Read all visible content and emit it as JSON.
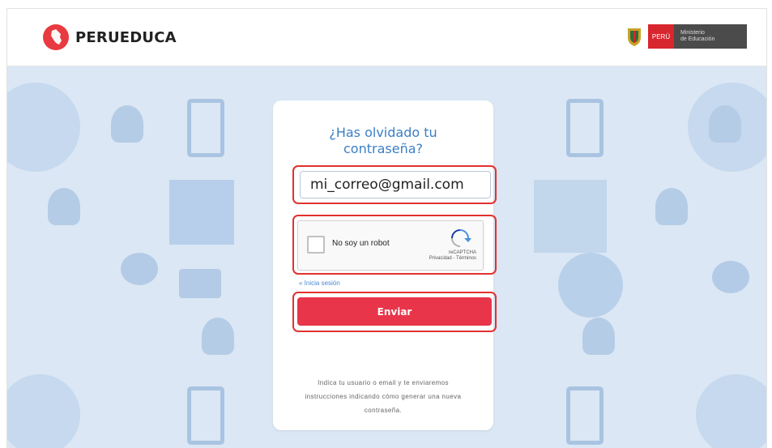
{
  "header": {
    "brand": "PERUEDUCA",
    "gov_peru": "PERÚ",
    "gov_ministry_line1": "Ministerio",
    "gov_ministry_line2": "de Educación"
  },
  "form": {
    "title_line1": "¿Has olvidado tu",
    "title_line2": "contraseña?",
    "email_value": "mi_correo@gmail.com",
    "captcha_label": "No soy un robot",
    "captcha_brand": "reCAPTCHA",
    "captcha_terms": "Privacidad - Términos",
    "back_link": "« Inicia sesión",
    "submit_label": "Enviar",
    "help_text": "Indica tu usuario o email y te enviaremos instrucciones indicando cómo generar una nueva contraseña."
  },
  "colors": {
    "accent": "#e8354a",
    "title": "#3b7fc4",
    "background": "#dbe7f4",
    "highlight": "#e0322f"
  }
}
